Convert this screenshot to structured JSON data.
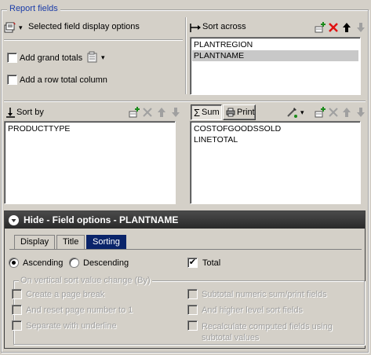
{
  "title": "Report fields",
  "top_left": {
    "display_options_label": "Selected field display options",
    "add_grand_totals_label": "Add grand totals",
    "add_grand_totals_checked": false,
    "add_row_total_label": "Add a row total column",
    "add_row_total_checked": false
  },
  "sort_across": {
    "label": "Sort across",
    "items": [
      {
        "text": "PLANTREGION",
        "selected": false
      },
      {
        "text": "PLANTNAME",
        "selected": true
      }
    ]
  },
  "sort_by": {
    "label": "Sort by",
    "items": [
      {
        "text": "PRODUCTTYPE",
        "selected": false
      }
    ]
  },
  "measures": {
    "sum_label": "Sum",
    "print_label": "Print",
    "items": [
      {
        "text": "COSTOFGOODSSOLD",
        "selected": false
      },
      {
        "text": "LINETOTAL",
        "selected": false
      }
    ]
  },
  "field_options": {
    "header": "Hide - Field options - PLANTNAME",
    "tabs": [
      "Display",
      "Title",
      "Sorting"
    ],
    "active_tab": "Sorting",
    "ascending_label": "Ascending",
    "descending_label": "Descending",
    "ascending_selected": true,
    "total_label": "Total",
    "total_checked": true,
    "group_label": "On vertical sort value change (By)",
    "options_left": [
      "Create a page break",
      "And reset page number to 1",
      "Separate with underline"
    ],
    "options_right": [
      "Subtotal numeric sum/print fields",
      "And higher level sort fields",
      "Recalculate computed fields using subtotal values"
    ]
  },
  "colors": {
    "legend_blue": "#1a3ca8",
    "active_tab": "#0a246a",
    "header_dark": "#333333",
    "delete_red": "#e01010"
  }
}
